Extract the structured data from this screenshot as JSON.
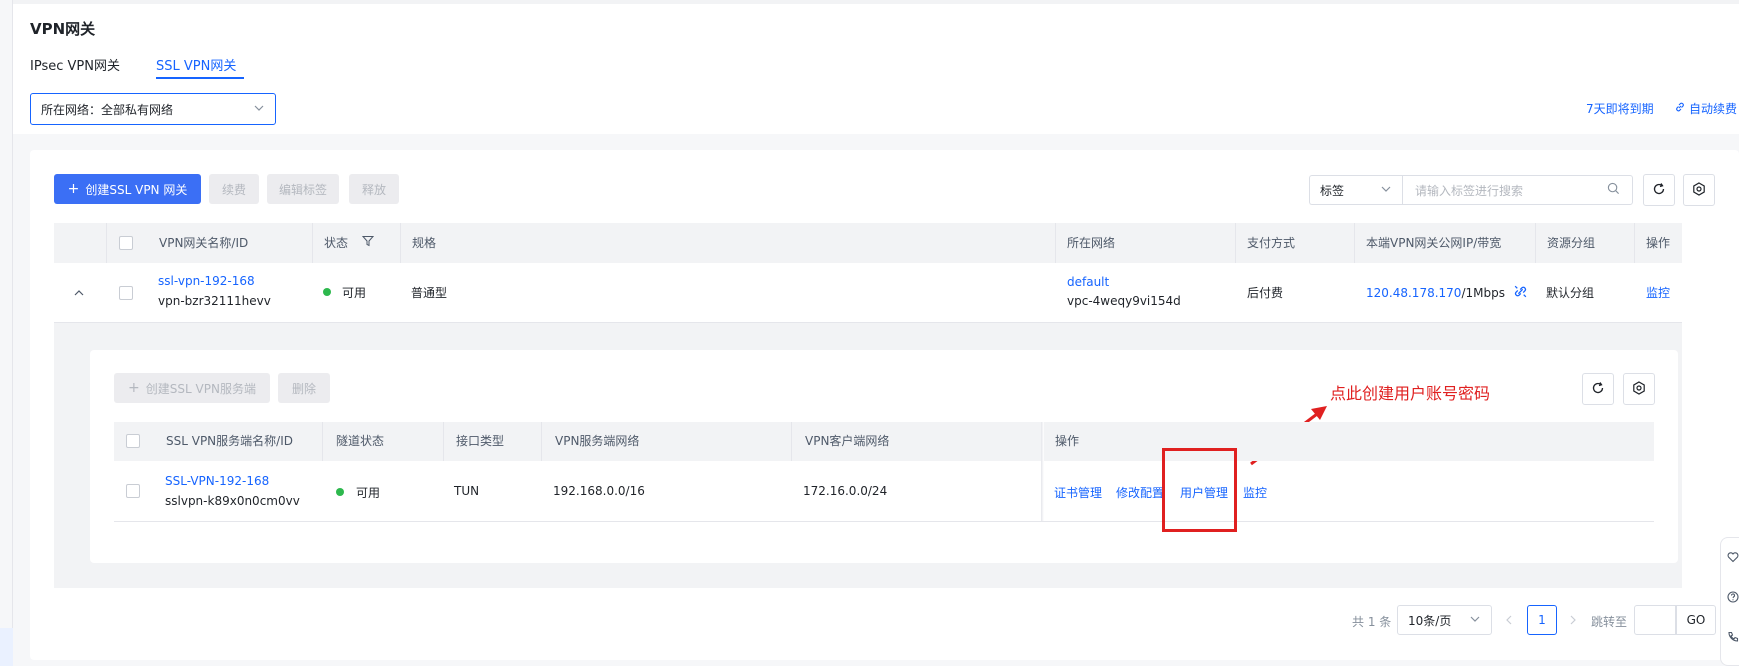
{
  "page": {
    "title": "VPN网关"
  },
  "tabs": [
    {
      "label": "IPsec VPN网关"
    },
    {
      "label": "SSL VPN网关"
    }
  ],
  "network_select": {
    "value": "所在网络：全部私有网络"
  },
  "top_links": {
    "expire": "7天即将到期",
    "auto_renew": "自动续费"
  },
  "toolbar": {
    "create": "创建SSL VPN 网关",
    "renew": "续费",
    "edit_tag": "编辑标签",
    "release": "释放",
    "tag_select": "标签",
    "search_placeholder": "请输入标签进行搜索"
  },
  "table": {
    "headers": [
      "VPN网关名称/ID",
      "状态",
      "规格",
      "所在网络",
      "支付方式",
      "本端VPN网关公网IP/带宽",
      "资源分组",
      "操作"
    ],
    "row": {
      "name": "ssl-vpn-192-168",
      "id": "vpn-bzr32111hevv",
      "status": "可用",
      "spec": "普通型",
      "network": "default",
      "vpc_id": "vpc-4weqy9vi154d",
      "payment": "后付费",
      "ip": "120.48.178.170",
      "bandwidth": "/1Mbps",
      "group": "默认分组",
      "action": "监控"
    }
  },
  "sub": {
    "create": "创建SSL VPN服务端",
    "delete": "删除",
    "headers": [
      "SSL VPN服务端名称/ID",
      "隧道状态",
      "接口类型",
      "VPN服务端网络",
      "VPN客户端网络",
      "操作"
    ],
    "row": {
      "name": "SSL-VPN-192-168",
      "id": "sslvpn-k89x0n0cm0vv",
      "status": "可用",
      "interface": "TUN",
      "server_net": "192.168.0.0/16",
      "client_net": "172.16.0.0/24",
      "actions": [
        "证书管理",
        "修改配置",
        "用户管理",
        "监控"
      ]
    }
  },
  "annotation": "点此创建用户账号密码",
  "pagination": {
    "total": "共 1 条",
    "page_size": "10条/页",
    "current": "1",
    "jump_label": "跳转至",
    "go": "GO"
  },
  "colors": {
    "accent": "#1664ff",
    "primary_button": "#3b6ff5",
    "annotation": "#e02020",
    "success": "#2db84d"
  }
}
